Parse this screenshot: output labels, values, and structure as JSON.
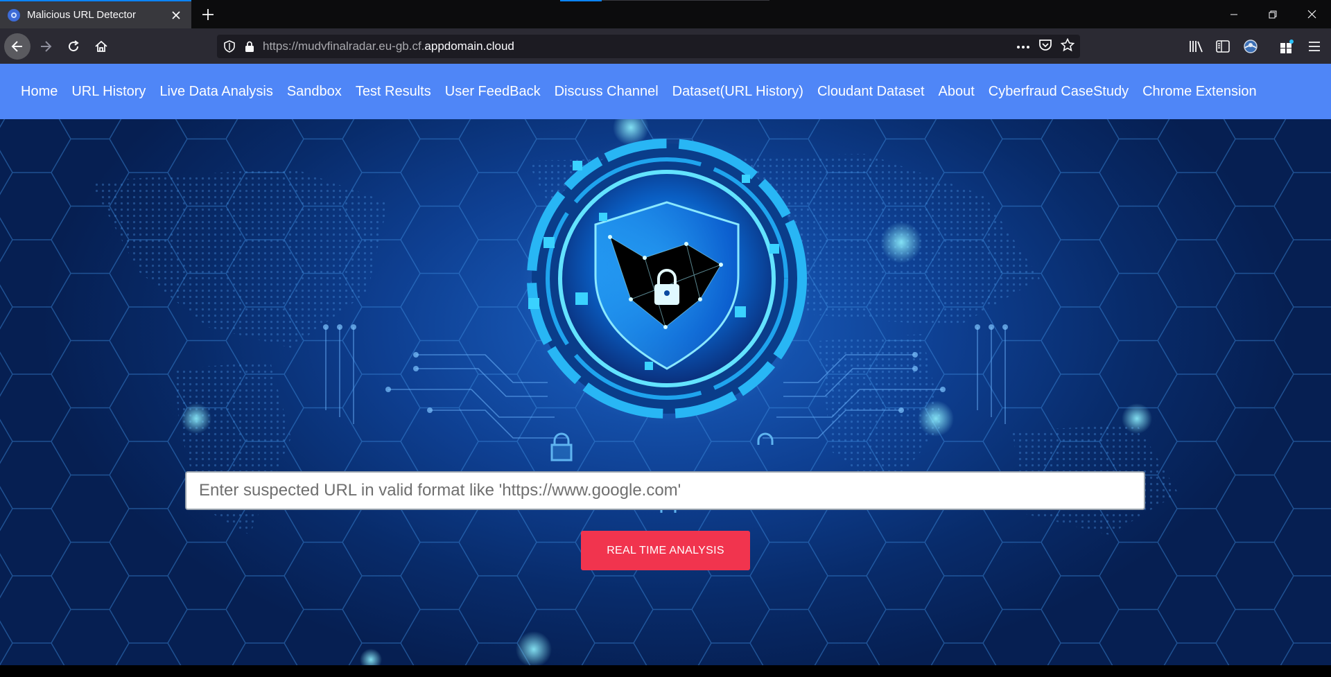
{
  "browser": {
    "tab": {
      "title": "Malicious URL Detector",
      "favicon": "shield-favicon"
    },
    "url": {
      "prefix": "https://mudvfinalradar.eu-gb.cf.",
      "host": "appdomain.cloud"
    },
    "icons": [
      "back-icon",
      "forward-icon",
      "reload-icon",
      "home-icon",
      "tracking-shield-icon",
      "lock-icon",
      "page-actions-icon",
      "pocket-icon",
      "bookmark-star-icon",
      "library-icon",
      "sidebar-icon",
      "account-icon",
      "extensions-icon",
      "menu-icon",
      "minimize-icon",
      "restore-icon",
      "close-icon"
    ]
  },
  "site_nav": {
    "links": [
      "Home",
      "URL History",
      "Live Data Analysis",
      "Sandbox",
      "Test Results",
      "User FeedBack",
      "Discuss Channel",
      "Dataset(URL History)",
      "Cloudant Dataset",
      "About",
      "Cyberfraud CaseStudy",
      "Chrome Extension"
    ]
  },
  "hero": {
    "input_placeholder": "Enter suspected URL in valid format like 'https://www.google.com'",
    "button_label": "REAL TIME ANALYSIS"
  },
  "colors": {
    "nav_bg": "#4f86f7",
    "button_bg": "#f1344e",
    "hero_bg": "#0e3f91",
    "accent": "#27d8ff"
  }
}
